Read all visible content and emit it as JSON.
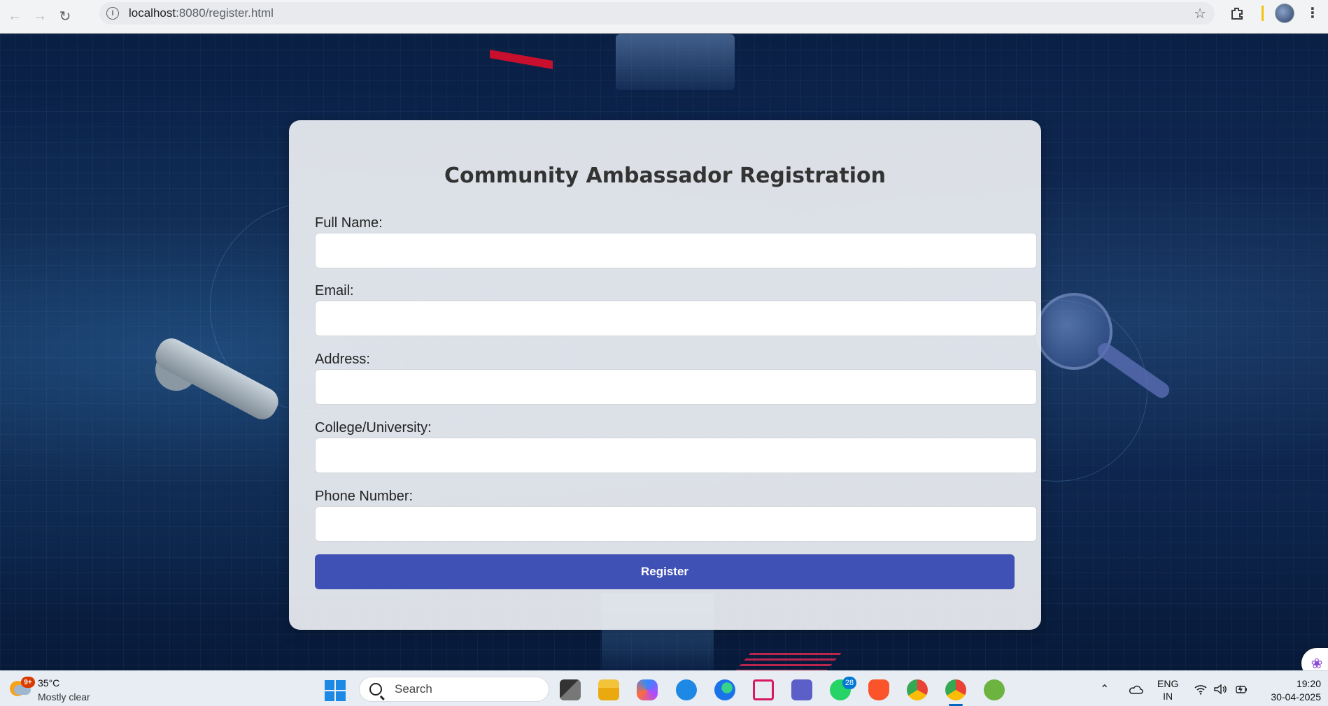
{
  "browser": {
    "url_host": "localhost",
    "url_rest": ":8080/register.html"
  },
  "form": {
    "title": "Community Ambassador Registration",
    "fields": [
      {
        "label": "Full Name:",
        "value": ""
      },
      {
        "label": "Email:",
        "value": ""
      },
      {
        "label": "Address:",
        "value": ""
      },
      {
        "label": "College/University:",
        "value": ""
      },
      {
        "label": "Phone Number:",
        "value": ""
      }
    ],
    "submit_label": "Register",
    "accent_color": "#3f51b5"
  },
  "taskbar": {
    "weather": {
      "badge": "9+",
      "temperature": "35°C",
      "description": "Mostly clear"
    },
    "search_text": "Search",
    "whatsapp_badge": "28",
    "language_line1": "ENG",
    "language_line2": "IN",
    "time": "19:20",
    "date": "30-04-2025"
  }
}
